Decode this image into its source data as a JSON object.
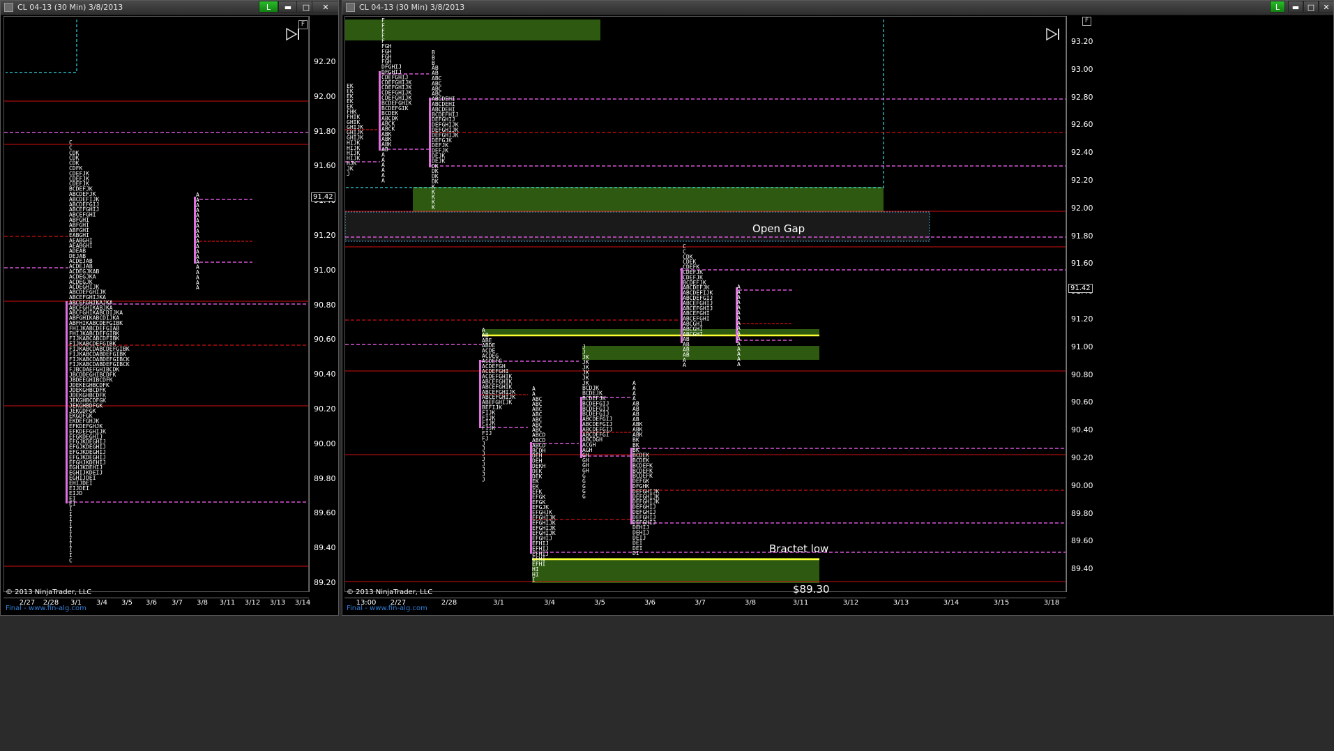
{
  "colors": {
    "accent_magenta": "#ff66ff",
    "red_line": "#d01010",
    "cyan_line": "#36d9e6",
    "green_zone": "#2d5a10",
    "yellow_line": "#ffff33",
    "tpo_bar": "#e070e0"
  },
  "left_window": {
    "title": "CL 04-13 (30 Min)  3/8/2013",
    "l_button": "L",
    "min_icon": "minimize-icon",
    "max_icon": "maximize-icon",
    "close_icon": "close-icon",
    "corner_button": "F",
    "copyright": "© 2013 NinjaTrader, LLC",
    "site": "Final - www.fin-alg.com",
    "price_tag": "91.42",
    "y_labels": [
      "92.20",
      "92.00",
      "91.80",
      "91.60",
      "91.40",
      "91.20",
      "91.00",
      "90.80",
      "90.60",
      "90.40",
      "90.20",
      "90.00",
      "89.80",
      "89.60",
      "89.40",
      "89.20"
    ],
    "x_labels": [
      "2/27",
      "2/28",
      "3/1",
      "3/4",
      "3/5",
      "3/6",
      "3/7",
      "3/8",
      "3/11",
      "3/12",
      "3/13",
      "3/14"
    ]
  },
  "right_window": {
    "title": "CL 04-13 (30 Min)  3/8/2013",
    "l_button": "L",
    "corner_button": "F",
    "copyright": "© 2013 NinjaTrader, LLC",
    "site": "Final - www.fin-alg.com",
    "price_tag": "91.42",
    "open_gap_label": "Open Gap",
    "bracket_low_label": "Bractet low",
    "bracket_low_price": "$89.30",
    "y_labels": [
      "93.20",
      "93.00",
      "92.80",
      "92.60",
      "92.40",
      "92.20",
      "92.00",
      "91.80",
      "91.60",
      "91.40",
      "91.20",
      "91.00",
      "90.80",
      "90.60",
      "90.40",
      "90.20",
      "90.00",
      "89.80",
      "89.60",
      "89.40"
    ],
    "x_labels": [
      "13:00",
      "2/27",
      "2/28",
      "3/1",
      "3/4",
      "3/5",
      "3/6",
      "3/7",
      "3/8",
      "3/11",
      "3/12",
      "3/13",
      "3/14",
      "3/15",
      "3/18"
    ]
  }
}
